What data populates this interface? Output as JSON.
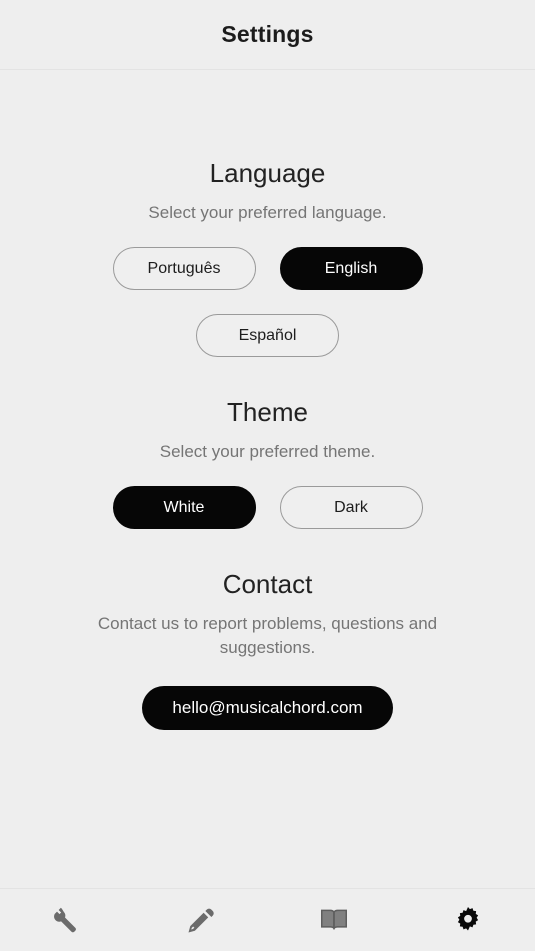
{
  "header": {
    "title": "Settings"
  },
  "theme_colors": {
    "background": "#eeeeee",
    "selected_fill": "#060606",
    "selected_text": "#ffffff",
    "unselected_border": "#9a9a9a",
    "unselected_text": "#1d1d1d",
    "title_text": "#222222",
    "subtitle_text": "#757575",
    "divider": "#e3e3e3",
    "nav_icon_inactive": "#6b6b6b",
    "nav_icon_active": "#0a0a0a"
  },
  "sections": {
    "language": {
      "title": "Language",
      "subtitle": "Select your preferred language.",
      "options": [
        {
          "label": "Português",
          "selected": false
        },
        {
          "label": "English",
          "selected": true
        },
        {
          "label": "Español",
          "selected": false
        }
      ]
    },
    "theme": {
      "title": "Theme",
      "subtitle": "Select your preferred theme.",
      "options": [
        {
          "label": "White",
          "selected": true
        },
        {
          "label": "Dark",
          "selected": false
        }
      ]
    },
    "contact": {
      "title": "Contact",
      "subtitle": "Contact us to report problems, questions and suggestions.",
      "email": "hello@musicalchord.com"
    }
  },
  "bottom_nav": {
    "items": [
      {
        "icon": "tools-icon",
        "active": false
      },
      {
        "icon": "pencil-icon",
        "active": false
      },
      {
        "icon": "book-icon",
        "active": false
      },
      {
        "icon": "gear-icon",
        "active": true
      }
    ]
  }
}
